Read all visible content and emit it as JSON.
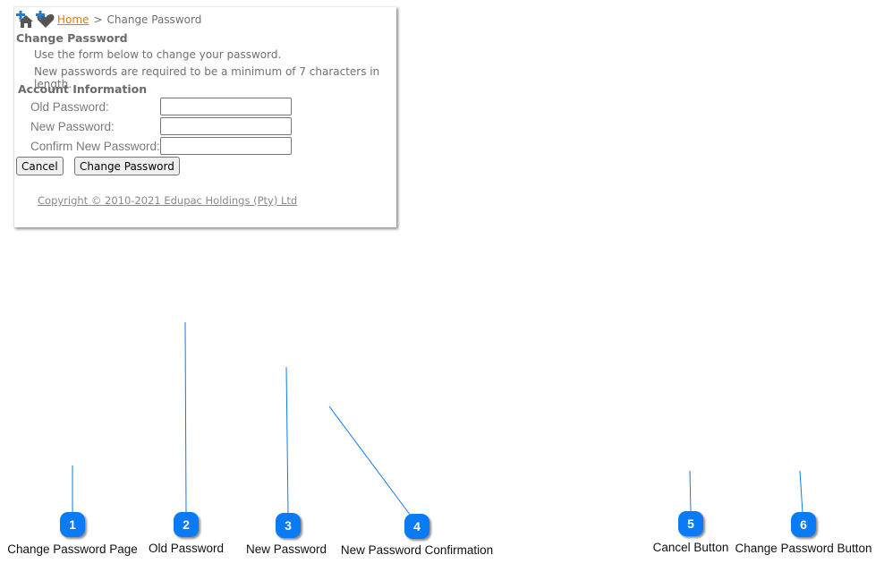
{
  "breadcrumb": {
    "icons": [
      "add-home-icon",
      "add-favorite-icon"
    ],
    "home_link": "Home",
    "separator": ">",
    "current": "Change Password"
  },
  "page": {
    "title": "Change Password",
    "instructions": [
      "Use the form below to change your password.",
      "New passwords are required to be a minimum of 7 characters in length."
    ],
    "section_title": "Account Information",
    "fields": [
      {
        "label": "Old Password:",
        "value": ""
      },
      {
        "label": "New Password:",
        "value": ""
      },
      {
        "label": "Confirm New Password:",
        "value": ""
      }
    ],
    "buttons": {
      "cancel": "Cancel",
      "change_password": "Change Password"
    },
    "copyright": "Copyright © 2010-2021 Edupac Holdings (Pty) Ltd"
  },
  "colors": {
    "callout": "#0a7bf5",
    "link": "#e07b00"
  },
  "callouts": [
    {
      "number": "1",
      "label": "Change Password Page"
    },
    {
      "number": "2",
      "label": "Old Password"
    },
    {
      "number": "3",
      "label": "New Password"
    },
    {
      "number": "4",
      "label": "New Password Confirmation"
    },
    {
      "number": "5",
      "label": "Cancel Button"
    },
    {
      "number": "6",
      "label": "Change Password Button"
    }
  ]
}
